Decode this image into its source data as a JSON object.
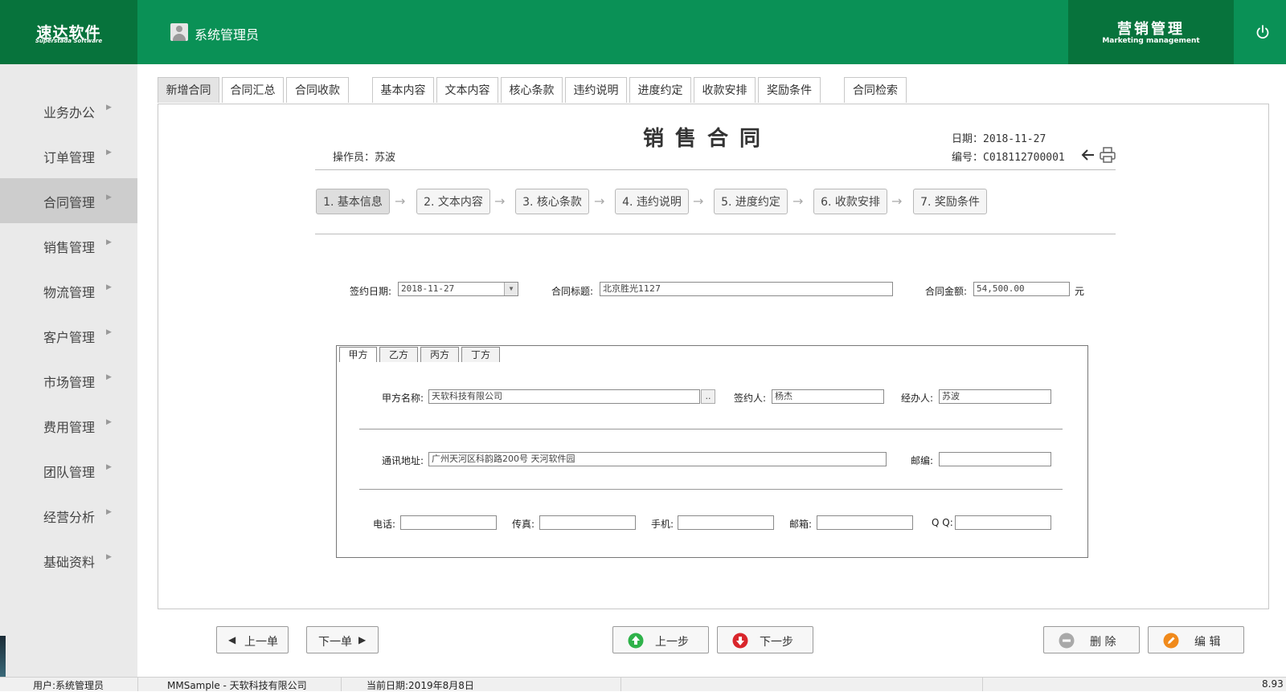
{
  "header": {
    "logo_cn": "速达软件",
    "logo_en": "Superstada Software",
    "user_name": "系统管理员",
    "module_cn": "营销管理",
    "module_en": "Marketing management"
  },
  "sidebar": {
    "items": [
      {
        "label": "业务办公"
      },
      {
        "label": "订单管理"
      },
      {
        "label": "合同管理"
      },
      {
        "label": "销售管理"
      },
      {
        "label": "物流管理"
      },
      {
        "label": "客户管理"
      },
      {
        "label": "市场管理"
      },
      {
        "label": "费用管理"
      },
      {
        "label": "团队管理"
      },
      {
        "label": "经营分析"
      },
      {
        "label": "基础资料"
      }
    ],
    "active": "合同管理"
  },
  "tabs": [
    {
      "label": "新增合同"
    },
    {
      "label": "合同汇总"
    },
    {
      "label": "合同收款"
    },
    {
      "label": "基本内容"
    },
    {
      "label": "文本内容"
    },
    {
      "label": "核心条款"
    },
    {
      "label": "违约说明"
    },
    {
      "label": "进度约定"
    },
    {
      "label": "收款安排"
    },
    {
      "label": "奖励条件"
    },
    {
      "label": "合同检索"
    }
  ],
  "doc": {
    "title": "销售合同",
    "operator": "操作员：苏波",
    "date": "日期：2018-11-27",
    "code": "编号：C018112700001"
  },
  "steps": [
    {
      "label": "1. 基本信息"
    },
    {
      "label": "2. 文本内容"
    },
    {
      "label": "3. 核心条款"
    },
    {
      "label": "4. 违约说明"
    },
    {
      "label": "5. 进度约定"
    },
    {
      "label": "6. 收款安排"
    },
    {
      "label": "7. 奖励条件"
    }
  ],
  "step_arrow": "→",
  "form": {
    "sign_date_label": "签约日期:",
    "sign_date_value": "2018-11-27",
    "contract_title_label": "合同标题:",
    "contract_title_value": "北京胜光1127",
    "amount_label": "合同金额:",
    "amount_value": "54,500.00",
    "amount_unit": "元"
  },
  "party_tabs": [
    {
      "label": "甲方"
    },
    {
      "label": "乙方"
    },
    {
      "label": "丙方"
    },
    {
      "label": "丁方"
    }
  ],
  "party": {
    "name_label": "甲方名称:",
    "name_value": "天软科技有限公司",
    "browse_label": "..",
    "signer_label": "签约人:",
    "signer_value": "杨杰",
    "handler_label": "经办人:",
    "handler_value": "苏波",
    "address_label": "通讯地址:",
    "address_value": "广州天河区科韵路200号 天河软件园",
    "zip_label": "邮编:",
    "zip_value": "",
    "phone_label": "电话:",
    "phone_value": "",
    "fax_label": "传真:",
    "fax_value": "",
    "mobile_label": "手机:",
    "mobile_value": "",
    "email_label": "邮箱:",
    "email_value": "",
    "qq_label": "Q Q:",
    "qq_value": ""
  },
  "buttons": {
    "prev_doc": "上一单",
    "next_doc": "下一单",
    "prev_step": "上一步",
    "next_step": "下一步",
    "delete": "删 除",
    "edit": "编 辑"
  },
  "status": {
    "user": "用户:系统管理员",
    "app": "MMSample - 天软科技有限公司",
    "date": "当前日期:2019年8月8日",
    "version": "8.93"
  },
  "colors": {
    "header_green": "#0a9156",
    "header_dark_green": "#07733c",
    "next_step_red": "#d9262c",
    "prev_step_green": "#2fb24a",
    "edit_orange": "#f08a1c"
  },
  "icons": [
    "user-avatar-icon",
    "power-icon",
    "back-arrow-icon",
    "print-icon",
    "dropdown-arrow-icon",
    "chevron-right-icon",
    "arrow-up-circle-icon",
    "arrow-down-circle-icon",
    "minus-circle-icon",
    "pencil-icon",
    "triangle-left-icon",
    "triangle-right-icon"
  ]
}
